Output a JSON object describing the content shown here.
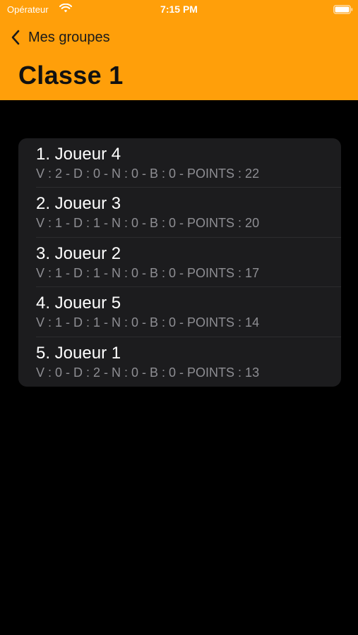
{
  "status_bar": {
    "carrier": "Opérateur",
    "time": "7:15 PM",
    "wifi_icon": "wifi-icon",
    "battery_icon": "battery-icon"
  },
  "nav": {
    "back_label": "Mes groupes",
    "back_icon": "chevron-left-icon",
    "title": "Classe 1"
  },
  "colors": {
    "header_background": "#FF9F0A",
    "page_background": "#000000",
    "card_background": "#1C1C1E",
    "secondary_text": "#8E8E93"
  },
  "ranking": [
    {
      "title": "1. Joueur 4",
      "stats": "V : 2 - D : 0 - N : 0 - B : 0 - POINTS : 22"
    },
    {
      "title": "2. Joueur 3",
      "stats": "V : 1 - D : 1 - N : 0 - B : 0 - POINTS : 20"
    },
    {
      "title": "3. Joueur 2",
      "stats": "V : 1 - D : 1 - N : 0 - B : 0 - POINTS : 17"
    },
    {
      "title": "4. Joueur 5",
      "stats": "V : 1 - D : 1 - N : 0 - B : 0 - POINTS : 14"
    },
    {
      "title": "5. Joueur 1",
      "stats": "V : 0 - D : 2 - N : 0 - B : 0 - POINTS : 13"
    }
  ]
}
